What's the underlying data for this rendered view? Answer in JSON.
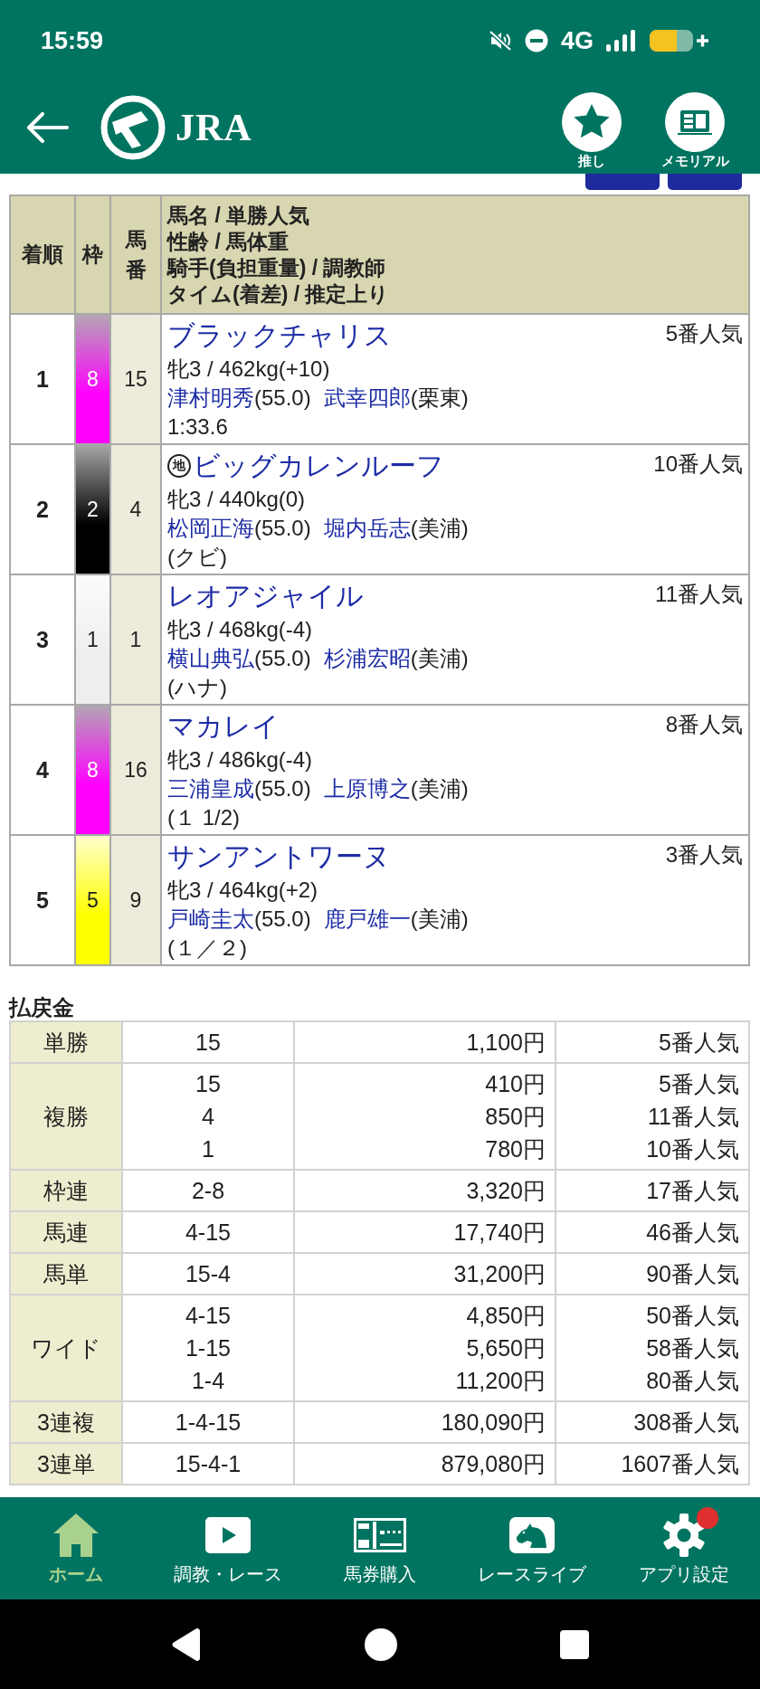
{
  "status_bar": {
    "time": "15:59",
    "network": "4G"
  },
  "header": {
    "logo_text": "JRA",
    "actions": [
      {
        "label": "推し"
      },
      {
        "label": "メモリアル"
      }
    ]
  },
  "results_table": {
    "columns": [
      "着順",
      "枠",
      "馬番"
    ],
    "detail_column": [
      "馬名 / 単勝人気",
      "性齢 / 馬体重",
      "騎手(負担重量) / 調教師",
      "タイム(着差) / 推定上り"
    ],
    "rows": [
      {
        "rank": "1",
        "frame": "8",
        "color": "#ff00ff",
        "number": "15",
        "name": "ブラックチャリス",
        "popularity": "5番人気",
        "sex_age_weight": "牝3 / 462kg(+10)",
        "jockey": "津村明秀",
        "jockey_weight": "(55.0)",
        "trainer": "武幸四郎",
        "stable": "(栗東)",
        "time_margin": "1:33.6"
      },
      {
        "rank": "2",
        "frame": "2",
        "color": "#000000",
        "number": "4",
        "badge": "地",
        "name": "ビッグカレンルーフ",
        "popularity": "10番人気",
        "sex_age_weight": "牝3 / 440kg(0)",
        "jockey": "松岡正海",
        "jockey_weight": "(55.0)",
        "trainer": "堀内岳志",
        "stable": "(美浦)",
        "time_margin": "(クビ)"
      },
      {
        "rank": "3",
        "frame": "1",
        "color": "#eeeeee",
        "number": "1",
        "name": "レオアジャイル",
        "popularity": "11番人気",
        "sex_age_weight": "牝3 / 468kg(-4)",
        "jockey": "横山典弘",
        "jockey_weight": "(55.0)",
        "trainer": "杉浦宏昭",
        "stable": "(美浦)",
        "time_margin": "(ハナ)"
      },
      {
        "rank": "4",
        "frame": "8",
        "color": "#ff00ff",
        "number": "16",
        "name": "マカレイ",
        "popularity": "8番人気",
        "sex_age_weight": "牝3 / 486kg(-4)",
        "jockey": "三浦皇成",
        "jockey_weight": "(55.0)",
        "trainer": "上原博之",
        "stable": "(美浦)",
        "time_margin": "(１ 1/2)"
      },
      {
        "rank": "5",
        "frame": "5",
        "color": "#ffff00",
        "number": "9",
        "name": "サンアントワーヌ",
        "popularity": "3番人気",
        "sex_age_weight": "牝3 / 464kg(+2)",
        "jockey": "戸崎圭太",
        "jockey_weight": "(55.0)",
        "trainer": "鹿戸雄一",
        "stable": "(美浦)",
        "time_margin": "(１／２)"
      }
    ]
  },
  "payouts": {
    "title": "払戻金",
    "rows": [
      {
        "bet_type": "単勝",
        "entries": [
          {
            "combination": "15",
            "amount": "1,100円",
            "popularity": "5番人気"
          }
        ]
      },
      {
        "bet_type": "複勝",
        "entries": [
          {
            "combination": "15",
            "amount": "410円",
            "popularity": "5番人気"
          },
          {
            "combination": "4",
            "amount": "850円",
            "popularity": "11番人気"
          },
          {
            "combination": "1",
            "amount": "780円",
            "popularity": "10番人気"
          }
        ]
      },
      {
        "bet_type": "枠連",
        "entries": [
          {
            "combination": "2-8",
            "amount": "3,320円",
            "popularity": "17番人気"
          }
        ]
      },
      {
        "bet_type": "馬連",
        "entries": [
          {
            "combination": "4-15",
            "amount": "17,740円",
            "popularity": "46番人気"
          }
        ]
      },
      {
        "bet_type": "馬単",
        "entries": [
          {
            "combination": "15-4",
            "amount": "31,200円",
            "popularity": "90番人気"
          }
        ]
      },
      {
        "bet_type": "ワイド",
        "entries": [
          {
            "combination": "4-15",
            "amount": "4,850円",
            "popularity": "50番人気"
          },
          {
            "combination": "1-15",
            "amount": "5,650円",
            "popularity": "58番人気"
          },
          {
            "combination": "1-4",
            "amount": "11,200円",
            "popularity": "80番人気"
          }
        ]
      },
      {
        "bet_type": "3連複",
        "entries": [
          {
            "combination": "1-4-15",
            "amount": "180,090円",
            "popularity": "308番人気"
          }
        ]
      },
      {
        "bet_type": "3連単",
        "entries": [
          {
            "combination": "15-4-1",
            "amount": "879,080円",
            "popularity": "1607番人気"
          }
        ]
      }
    ]
  },
  "bottom_nav": [
    {
      "label": "ホーム",
      "selected": true,
      "notification": false
    },
    {
      "label": "調教・レース",
      "selected": false,
      "notification": false
    },
    {
      "label": "馬券購入",
      "selected": false,
      "notification": false
    },
    {
      "label": "レースライブ",
      "selected": false,
      "notification": false
    },
    {
      "label": "アプリ設定",
      "selected": false,
      "notification": true
    }
  ]
}
